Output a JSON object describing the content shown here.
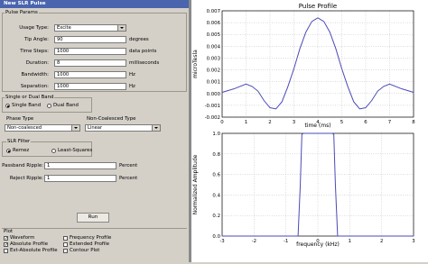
{
  "window": {
    "title": "New SLR Pulse"
  },
  "pulse_params": {
    "group_label": "Pulse Params",
    "usage_type": {
      "label": "Usage Type:",
      "value": "Excite"
    },
    "tip_angle": {
      "label": "Tip Angle:",
      "value": "90",
      "unit": "degrees"
    },
    "time_steps": {
      "label": "Time Steps:",
      "value": "1000",
      "unit": "data points"
    },
    "duration": {
      "label": "Duration:",
      "value": "8",
      "unit": "milliseconds"
    },
    "bandwidth": {
      "label": "Bandwidth:",
      "value": "1000",
      "unit": "Hz"
    },
    "separation": {
      "label": "Separation:",
      "value": "1000",
      "unit": "Hz"
    }
  },
  "band": {
    "group_label": "Single or Dual Band",
    "single_label": "Single Band",
    "dual_label": "Dual Band",
    "selected": "single"
  },
  "phase_type": {
    "label": "Phase Type",
    "value": "Non-coalesced"
  },
  "non_coalesced_type": {
    "label": "Non-Coalesced Type",
    "value": "Linear"
  },
  "slr_filter": {
    "group_label": "SLR Filter",
    "remez_label": "Remez",
    "least_squares_label": "Least-Squares",
    "selected": "remez"
  },
  "ripple": {
    "passband": {
      "label": "Passband Ripple:",
      "value": "1",
      "unit": "Percent"
    },
    "reject": {
      "label": "Reject Ripple:",
      "value": "1",
      "unit": "Percent"
    }
  },
  "run_button": "Run",
  "plot": {
    "group_label": "Plot",
    "options": [
      {
        "label": "Waveform",
        "checked": true
      },
      {
        "label": "Absolute Profile",
        "checked": true
      },
      {
        "label": "Ext-Absolute Profile",
        "checked": false
      },
      {
        "label": "Frequency Profile",
        "checked": false
      },
      {
        "label": "Extended Profile",
        "checked": false
      },
      {
        "label": "Contour Plot",
        "checked": false
      }
    ]
  },
  "icons": {
    "radio_on": "radio-selected-icon",
    "combo_arrow": "chevron-down-icon"
  },
  "chart_data": [
    {
      "type": "line",
      "title": "Pulse Profile",
      "xlabel": "time (ms)",
      "ylabel": "microTesla",
      "xlim": [
        0,
        8
      ],
      "ylim": [
        -0.002,
        0.007
      ],
      "x_ticks": [
        "0",
        "1",
        "2",
        "3",
        "4",
        "5",
        "6",
        "7",
        "8"
      ],
      "y_ticks": [
        "-0.002",
        "-0.001",
        "0.000",
        "0.001",
        "0.002",
        "0.003",
        "0.004",
        "0.005",
        "0.006",
        "0.007"
      ],
      "grid": true,
      "color": "#4a4ab8",
      "x": [
        0,
        0.5,
        1,
        1.25,
        1.5,
        1.75,
        2,
        2.25,
        2.5,
        2.75,
        3,
        3.25,
        3.5,
        3.75,
        4,
        4.25,
        4.5,
        4.75,
        5,
        5.25,
        5.5,
        5.75,
        6,
        6.25,
        6.5,
        6.75,
        7,
        7.5,
        8
      ],
      "y": [
        0.0001,
        0.0004,
        0.0008,
        0.0006,
        0.0002,
        -0.0006,
        -0.0012,
        -0.0013,
        -0.0007,
        0.0006,
        0.0021,
        0.0038,
        0.0052,
        0.0061,
        0.0064,
        0.0061,
        0.0052,
        0.0038,
        0.0021,
        0.0006,
        -0.0007,
        -0.0013,
        -0.0012,
        -0.0006,
        0.0002,
        0.0006,
        0.0008,
        0.0004,
        0.0001
      ]
    },
    {
      "type": "line",
      "title": "",
      "xlabel": "frequency (kHz)",
      "ylabel": "Normalized Amplitude",
      "xlim": [
        -3,
        3
      ],
      "ylim": [
        0,
        1.0
      ],
      "x_ticks": [
        "-3",
        "-2",
        "-1",
        "0",
        "1",
        "2",
        "3"
      ],
      "y_ticks": [
        "0.0",
        "0.2",
        "0.4",
        "0.6",
        "0.8",
        "1.0"
      ],
      "grid": true,
      "color": "#4a4ab8",
      "x": [
        -3,
        -0.62,
        -0.55,
        -0.5,
        -0.45,
        0.45,
        0.5,
        0.55,
        0.62,
        3
      ],
      "y": [
        0,
        0,
        0.5,
        0.99,
        1.0,
        1.0,
        0.99,
        0.5,
        0,
        0
      ]
    }
  ]
}
